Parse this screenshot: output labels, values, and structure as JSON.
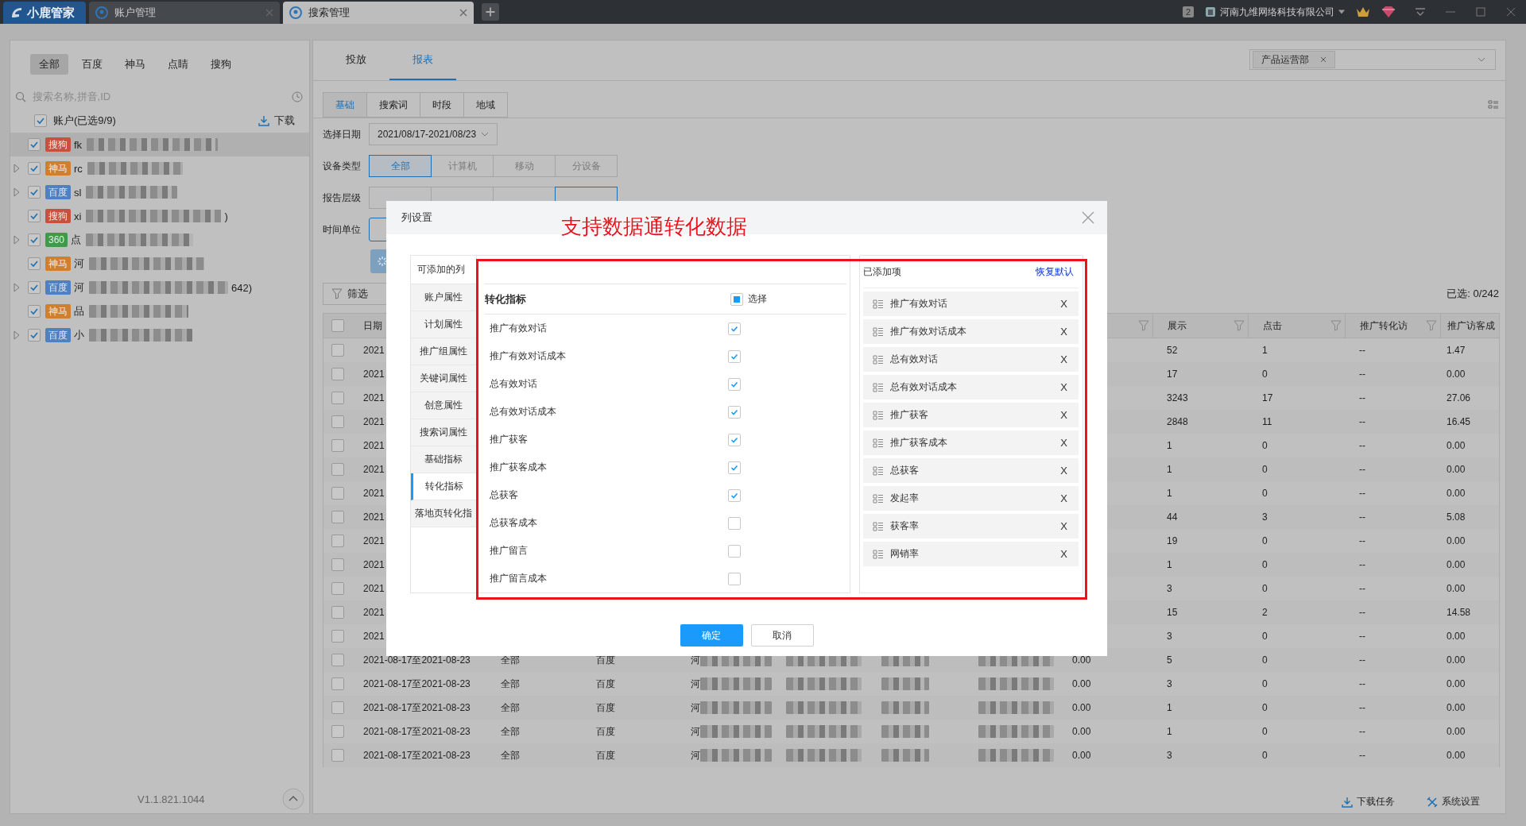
{
  "app_tabs": {
    "logo": "小鹿管家",
    "tabs": [
      {
        "label": "账户管理",
        "selected": false
      },
      {
        "label": "搜索管理",
        "selected": true
      }
    ]
  },
  "title_bar": {
    "badge": "2",
    "company": "河南九维网络科技有限公司"
  },
  "sidebar": {
    "filters": [
      {
        "label": "全部",
        "selected": true
      },
      {
        "label": "百度",
        "selected": false
      },
      {
        "label": "神马",
        "selected": false
      },
      {
        "label": "点睛",
        "selected": false
      },
      {
        "label": "搜狗",
        "selected": false
      }
    ],
    "search": {
      "placeholder": "搜索名称,拼音,ID"
    },
    "all_accounts": {
      "label": "账户(已选9/9)",
      "checked": true
    },
    "download": "下载",
    "accounts": [
      {
        "tag": "搜狗",
        "color": "#c8503f",
        "name": "fk",
        "expandable": false,
        "checked": true,
        "selected": true
      },
      {
        "tag": "神马",
        "color": "#d0802c",
        "name": "rc",
        "expandable": true,
        "checked": true,
        "selected": false
      },
      {
        "tag": "百度",
        "color": "#4f80c0",
        "name": "sl",
        "expandable": true,
        "checked": true,
        "selected": false
      },
      {
        "tag": "搜狗",
        "color": "#c8503f",
        "name": "xi",
        "tail": ")",
        "expandable": false,
        "checked": true,
        "selected": false
      },
      {
        "tag": "360",
        "color": "#3f9a4a",
        "name": "点",
        "expandable": true,
        "checked": true,
        "selected": false
      },
      {
        "tag": "神马",
        "color": "#d0802c",
        "name": "河",
        "expandable": false,
        "checked": true,
        "selected": false
      },
      {
        "tag": "百度",
        "color": "#4f80c0",
        "name": "河",
        "tail": "642)",
        "expandable": true,
        "checked": true,
        "selected": false
      },
      {
        "tag": "神马",
        "color": "#d0802c",
        "name": "品",
        "expandable": false,
        "checked": true,
        "selected": false
      },
      {
        "tag": "百度",
        "color": "#4f80c0",
        "name": "小",
        "expandable": true,
        "checked": true,
        "selected": false
      }
    ],
    "version": "V1.1.821.1044"
  },
  "main_tabs": [
    {
      "label": "投放",
      "selected": false
    },
    {
      "label": "报表",
      "selected": true
    }
  ],
  "department_select": {
    "tags": [
      "产品运营部"
    ]
  },
  "sub_tabs": [
    {
      "label": "基础",
      "selected": true
    },
    {
      "label": "搜索词",
      "selected": false
    },
    {
      "label": "时段",
      "selected": false
    },
    {
      "label": "地域",
      "selected": false
    }
  ],
  "date_filter": {
    "label": "选择日期",
    "value": "2021/08/17-2021/08/23"
  },
  "device_filter": {
    "label": "设备类型",
    "options": [
      {
        "label": "全部",
        "selected": true
      },
      {
        "label": "计算机",
        "selected": false
      },
      {
        "label": "移动",
        "selected": false
      },
      {
        "label": "分设备",
        "selected": false
      }
    ]
  },
  "level_filter": {
    "label": "报告层级",
    "options": [
      {
        "selected": false
      },
      {
        "selected": false
      },
      {
        "selected": false
      },
      {
        "selected": true
      }
    ]
  },
  "time_unit_filter": {
    "label": "时间单位"
  },
  "filter_button": "筛选",
  "selected_count": "已选: 0/242",
  "table": {
    "header_checked": false,
    "columns": {
      "date": "日期",
      "impressions": "展示",
      "clicks": "点击",
      "conversions": "推广转化访",
      "visitor_cost": "推广访客成"
    },
    "rows": [
      {
        "checked": false,
        "date": "2021",
        "impressions": "52",
        "clicks": "1",
        "conversions": "--",
        "visitor_cost": "1.47"
      },
      {
        "checked": false,
        "date": "2021",
        "impressions": "17",
        "clicks": "0",
        "conversions": "--",
        "visitor_cost": "0.00"
      },
      {
        "checked": false,
        "date": "2021",
        "impressions": "3243",
        "clicks": "17",
        "conversions": "--",
        "visitor_cost": "27.06"
      },
      {
        "checked": false,
        "date": "2021",
        "impressions": "2848",
        "clicks": "11",
        "conversions": "--",
        "visitor_cost": "16.45"
      },
      {
        "checked": false,
        "date": "2021",
        "impressions": "1",
        "clicks": "0",
        "conversions": "--",
        "visitor_cost": "0.00"
      },
      {
        "checked": false,
        "date": "2021",
        "impressions": "1",
        "clicks": "0",
        "conversions": "--",
        "visitor_cost": "0.00"
      },
      {
        "checked": false,
        "date": "2021",
        "impressions": "1",
        "clicks": "0",
        "conversions": "--",
        "visitor_cost": "0.00"
      },
      {
        "checked": false,
        "date": "2021",
        "impressions": "44",
        "clicks": "3",
        "conversions": "--",
        "visitor_cost": "5.08"
      },
      {
        "checked": false,
        "date": "2021",
        "impressions": "19",
        "clicks": "0",
        "conversions": "--",
        "visitor_cost": "0.00"
      },
      {
        "checked": false,
        "date": "2021",
        "impressions": "1",
        "clicks": "0",
        "conversions": "--",
        "visitor_cost": "0.00"
      },
      {
        "checked": false,
        "date": "2021",
        "impressions": "3",
        "clicks": "0",
        "conversions": "--",
        "visitor_cost": "0.00"
      },
      {
        "checked": false,
        "date": "2021",
        "impressions": "15",
        "clicks": "2",
        "conversions": "--",
        "visitor_cost": "14.58"
      },
      {
        "checked": false,
        "date": "2021",
        "impressions": "3",
        "clicks": "0",
        "conversions": "--",
        "visitor_cost": "0.00"
      },
      {
        "checked": false,
        "date": "2021-08-17至2021-08-23",
        "device": "全部",
        "engine": "百度",
        "column_4": "河",
        "column_8": "0.00",
        "impressions": "5",
        "clicks": "0",
        "conversions": "--",
        "visitor_cost": "0.00"
      },
      {
        "checked": false,
        "date": "2021-08-17至2021-08-23",
        "device": "全部",
        "engine": "百度",
        "column_4": "河",
        "column_8": "0.00",
        "impressions": "3",
        "clicks": "0",
        "conversions": "--",
        "visitor_cost": "0.00"
      },
      {
        "checked": false,
        "date": "2021-08-17至2021-08-23",
        "device": "全部",
        "engine": "百度",
        "column_4": "河",
        "column_8": "0.00",
        "impressions": "1",
        "clicks": "0",
        "conversions": "--",
        "visitor_cost": "0.00"
      },
      {
        "checked": false,
        "date": "2021-08-17至2021-08-23",
        "device": "全部",
        "engine": "百度",
        "column_4": "河",
        "column_8": "0.00",
        "impressions": "1",
        "clicks": "0",
        "conversions": "--",
        "visitor_cost": "0.00"
      },
      {
        "checked": false,
        "date": "2021-08-17至2021-08-23",
        "device": "全部",
        "engine": "百度",
        "column_4": "河",
        "column_8": "0.00",
        "impressions": "3",
        "clicks": "0",
        "conversions": "--",
        "visitor_cost": "0.00"
      }
    ]
  },
  "footer": {
    "download_tasks": "下载任务",
    "system_settings": "系统设置"
  },
  "column_settings": {
    "title": "列设置",
    "annotation": "支持数据通转化数据",
    "categories_heading": "可添加的列",
    "categories": [
      {
        "label": "账户属性",
        "selected": false
      },
      {
        "label": "计划属性",
        "selected": false
      },
      {
        "label": "推广组属性",
        "selected": false
      },
      {
        "label": "关键词属性",
        "selected": false
      },
      {
        "label": "创意属性",
        "selected": false
      },
      {
        "label": "搜索词属性",
        "selected": false
      },
      {
        "label": "基础指标",
        "selected": false
      },
      {
        "label": "转化指标",
        "selected": true
      },
      {
        "label": "落地页转化指",
        "selected": false
      }
    ],
    "group_title": "转化指标",
    "select_all": {
      "label": "选择",
      "indeterminate": true
    },
    "metrics": [
      {
        "label": "推广有效对话",
        "checked": true
      },
      {
        "label": "推广有效对话成本",
        "checked": true
      },
      {
        "label": "总有效对话",
        "checked": true
      },
      {
        "label": "总有效对话成本",
        "checked": true
      },
      {
        "label": "推广获客",
        "checked": true
      },
      {
        "label": "推广获客成本",
        "checked": true
      },
      {
        "label": "总获客",
        "checked": true
      },
      {
        "label": "总获客成本",
        "checked": false
      },
      {
        "label": "推广留言",
        "checked": false
      },
      {
        "label": "推广留言成本",
        "checked": false
      }
    ],
    "added_heading": "已添加项",
    "reset": "恢复默认",
    "added": [
      {
        "label": "推广有效对话",
        "remove": "X"
      },
      {
        "label": "推广有效对话成本",
        "remove": "X"
      },
      {
        "label": "总有效对话",
        "remove": "X"
      },
      {
        "label": "总有效对话成本",
        "remove": "X"
      },
      {
        "label": "推广获客",
        "remove": "X"
      },
      {
        "label": "推广获客成本",
        "remove": "X"
      },
      {
        "label": "总获客",
        "remove": "X"
      },
      {
        "label": "发起率",
        "remove": "X"
      },
      {
        "label": "获客率",
        "remove": "X"
      },
      {
        "label": "网销率",
        "remove": "X"
      }
    ],
    "buttons": [
      {
        "label": "确定",
        "kind": "primary"
      },
      {
        "label": "取消",
        "kind": "default"
      }
    ]
  }
}
